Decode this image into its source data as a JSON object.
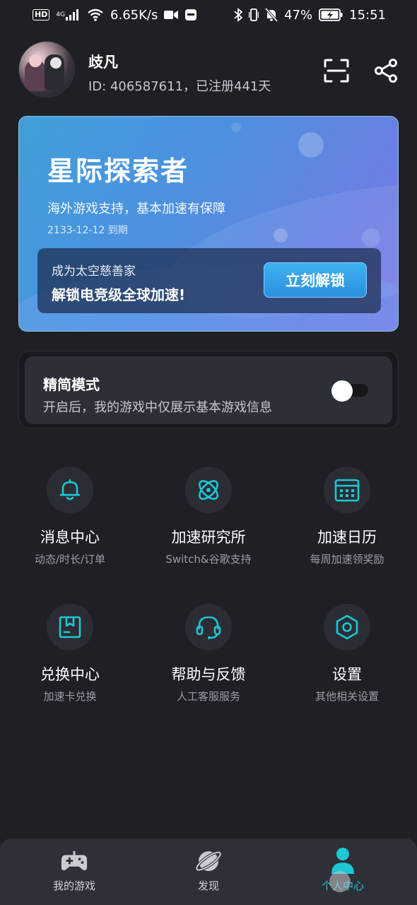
{
  "status_bar": {
    "hd": "HD",
    "network": "4G",
    "speed": "6.65K/s",
    "battery": "47%",
    "time": "15:51"
  },
  "profile": {
    "name": "歧凡",
    "id_line": "ID: 406587611，已注册441天"
  },
  "banner": {
    "title": "星际探索者",
    "description": "海外游戏支持，基本加速有保障",
    "expire": "2133-12-12 到期",
    "unlock_sub": "成为太空慈善家",
    "unlock_main": "解锁电竞级全球加速!",
    "unlock_button": "立刻解锁"
  },
  "simple_mode": {
    "title": "精简模式",
    "description": "开启后，我的游戏中仅展示基本游戏信息",
    "enabled": false
  },
  "grid": [
    {
      "label": "消息中心",
      "sublabel": "动态/时长/订单",
      "icon": "bell-icon"
    },
    {
      "label": "加速研究所",
      "sublabel": "Switch&谷歌支持",
      "icon": "atom-icon"
    },
    {
      "label": "加速日历",
      "sublabel": "每周加速领奖励",
      "icon": "calendar-icon"
    },
    {
      "label": "兑换中心",
      "sublabel": "加速卡兑换",
      "icon": "gift-box-icon"
    },
    {
      "label": "帮助与反馈",
      "sublabel": "人工客服服务",
      "icon": "headset-icon"
    },
    {
      "label": "设置",
      "sublabel": "其他相关设置",
      "icon": "settings-hex-icon"
    }
  ],
  "nav": [
    {
      "label": "我的游戏",
      "icon": "gamepad-icon",
      "active": false
    },
    {
      "label": "发现",
      "icon": "planet-icon",
      "active": false
    },
    {
      "label": "个人中心",
      "icon": "person-icon",
      "active": true
    }
  ],
  "colors": {
    "background": "#1f2026",
    "accent": "#1cc7d6",
    "banner_start": "#3f9fd9",
    "banner_end": "#7c7be6"
  }
}
